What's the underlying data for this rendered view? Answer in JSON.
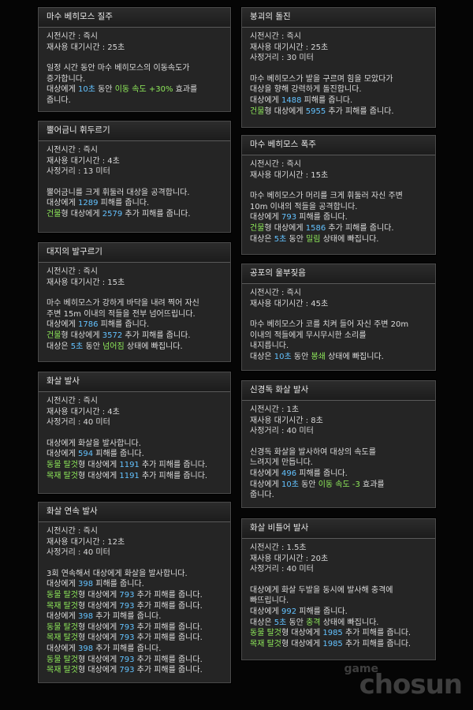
{
  "left": [
    {
      "title": "마수 베히모스 질주",
      "stats": [
        "시전시간 : 즉시",
        "재사용 대기시간 : 25초"
      ],
      "desc": [
        [
          {
            "t": "일정 시간 동안 마수 베히모스의 이동속도가",
            "c": "w"
          }
        ],
        [
          {
            "t": "증가합니다.",
            "c": "w"
          }
        ],
        [
          {
            "t": "대상에게 ",
            "c": "w"
          },
          {
            "t": "10초",
            "c": "b"
          },
          {
            "t": " 동안 ",
            "c": "w"
          },
          {
            "t": "이동 속도 +30%",
            "c": "g"
          },
          {
            "t": " 효과를",
            "c": "w"
          }
        ],
        [
          {
            "t": "줍니다.",
            "c": "w"
          }
        ]
      ]
    },
    {
      "title": "뿔어금니 휘두르기",
      "stats": [
        "시전시간 : 즉시",
        "재사용 대기시간 : 4초",
        "사정거리 : 13 미터"
      ],
      "desc": [
        [
          {
            "t": "뿔어금니를 크게 휘둘러 대상을 공격합니다.",
            "c": "w"
          }
        ],
        [
          {
            "t": "대상에게 ",
            "c": "w"
          },
          {
            "t": "1289",
            "c": "b"
          },
          {
            "t": " 피해를 줍니다.",
            "c": "w"
          }
        ],
        [
          {
            "t": "건물",
            "c": "g"
          },
          {
            "t": "형 대상에게 ",
            "c": "w"
          },
          {
            "t": "2579",
            "c": "b"
          },
          {
            "t": " 추가 피해를 줍니다.",
            "c": "w"
          }
        ]
      ]
    },
    {
      "title": "대지의 발구르기",
      "stats": [
        "시전시간 : 즉시",
        "재사용 대기시간 : 15초"
      ],
      "desc": [
        [
          {
            "t": "마수 베히모스가 강하게 바닥을 내려 찍어 자신",
            "c": "w"
          }
        ],
        [
          {
            "t": "주변 15m 이내의 적들을 전부 넘어뜨립니다.",
            "c": "w"
          }
        ],
        [
          {
            "t": "대상에게 ",
            "c": "w"
          },
          {
            "t": "1786",
            "c": "b"
          },
          {
            "t": " 피해를 줍니다.",
            "c": "w"
          }
        ],
        [
          {
            "t": "건물",
            "c": "g"
          },
          {
            "t": "형 대상에게 ",
            "c": "w"
          },
          {
            "t": "3572",
            "c": "b"
          },
          {
            "t": " 추가 피해를 줍니다.",
            "c": "w"
          }
        ],
        [
          {
            "t": "대상은 ",
            "c": "w"
          },
          {
            "t": "5초",
            "c": "b"
          },
          {
            "t": " 동안 ",
            "c": "w"
          },
          {
            "t": "넘어짐",
            "c": "g"
          },
          {
            "t": " 상태에 빠집니다.",
            "c": "w"
          }
        ]
      ]
    },
    {
      "title": "화살 발사",
      "stats": [
        "시전시간 : 즉시",
        "재사용 대기시간 : 4초",
        "사정거리 : 40 미터"
      ],
      "desc": [
        [
          {
            "t": "대상에게 화살을 발사합니다.",
            "c": "w"
          }
        ],
        [
          {
            "t": "대상에게 ",
            "c": "w"
          },
          {
            "t": "594",
            "c": "b"
          },
          {
            "t": " 피해를 줍니다.",
            "c": "w"
          }
        ],
        [
          {
            "t": "동물 탈것",
            "c": "g"
          },
          {
            "t": "형 대상에게 ",
            "c": "w"
          },
          {
            "t": "1191",
            "c": "b"
          },
          {
            "t": " 추가 피해를 줍니다.",
            "c": "w"
          }
        ],
        [
          {
            "t": "목재 탈것",
            "c": "g"
          },
          {
            "t": "형 대상에게 ",
            "c": "w"
          },
          {
            "t": "1191",
            "c": "b"
          },
          {
            "t": " 추가 피해를 줍니다.",
            "c": "w"
          }
        ]
      ]
    },
    {
      "title": "화살 연속 발사",
      "stats": [
        "시전시간 : 즉시",
        "재사용 대기시간 : 12초",
        "사정거리 : 40 미터"
      ],
      "desc": [
        [
          {
            "t": "3회 연속해서 대상에게 화살을 발사합니다.",
            "c": "w"
          }
        ],
        [
          {
            "t": "대상에게 ",
            "c": "w"
          },
          {
            "t": "398",
            "c": "b"
          },
          {
            "t": " 피해를 줍니다.",
            "c": "w"
          }
        ],
        [
          {
            "t": "동물 탈것",
            "c": "g"
          },
          {
            "t": "형 대상에게 ",
            "c": "w"
          },
          {
            "t": "793",
            "c": "b"
          },
          {
            "t": " 추가 피해를 줍니다.",
            "c": "w"
          }
        ],
        [
          {
            "t": "목재 탈것",
            "c": "g"
          },
          {
            "t": "형 대상에게 ",
            "c": "w"
          },
          {
            "t": "793",
            "c": "b"
          },
          {
            "t": " 추가 피해를 줍니다.",
            "c": "w"
          }
        ],
        [
          {
            "t": "대상에게 ",
            "c": "w"
          },
          {
            "t": "398",
            "c": "b"
          },
          {
            "t": " 추가 피해를 줍니다.",
            "c": "w"
          }
        ],
        [
          {
            "t": "동물 탈것",
            "c": "g"
          },
          {
            "t": "형 대상에게 ",
            "c": "w"
          },
          {
            "t": "793",
            "c": "b"
          },
          {
            "t": " 추가 피해를 줍니다.",
            "c": "w"
          }
        ],
        [
          {
            "t": "목재 탈것",
            "c": "g"
          },
          {
            "t": "형 대상에게 ",
            "c": "w"
          },
          {
            "t": "793",
            "c": "b"
          },
          {
            "t": " 추가 피해를 줍니다.",
            "c": "w"
          }
        ],
        [
          {
            "t": "대상에게 ",
            "c": "w"
          },
          {
            "t": "398",
            "c": "b"
          },
          {
            "t": " 추가 피해를 줍니다.",
            "c": "w"
          }
        ],
        [
          {
            "t": "동물 탈것",
            "c": "g"
          },
          {
            "t": "형 대상에게 ",
            "c": "w"
          },
          {
            "t": "793",
            "c": "b"
          },
          {
            "t": " 추가 피해를 줍니다.",
            "c": "w"
          }
        ],
        [
          {
            "t": "목재 탈것",
            "c": "g"
          },
          {
            "t": "형 대상에게 ",
            "c": "w"
          },
          {
            "t": "793",
            "c": "b"
          },
          {
            "t": " 추가 피해를 줍니다.",
            "c": "w"
          }
        ]
      ]
    }
  ],
  "right": [
    {
      "title": "붕괴의 돌진",
      "stats": [
        "시전시간 : 즉시",
        "재사용 대기시간 : 25초",
        "사정거리 : 30 미터"
      ],
      "desc": [
        [
          {
            "t": "마수 베히모스가 발을 구르며 힘을 모았다가",
            "c": "w"
          }
        ],
        [
          {
            "t": "대상을 향해 강력하게 돌진합니다.",
            "c": "w"
          }
        ],
        [
          {
            "t": "대상에게 ",
            "c": "w"
          },
          {
            "t": "1488",
            "c": "b"
          },
          {
            "t": " 피해를 줍니다.",
            "c": "w"
          }
        ],
        [
          {
            "t": "건물",
            "c": "g"
          },
          {
            "t": "형 대상에게 ",
            "c": "w"
          },
          {
            "t": "5955",
            "c": "b"
          },
          {
            "t": " 추가 피해를 줍니다.",
            "c": "w"
          }
        ]
      ]
    },
    {
      "title": "마수 베히모스 폭주",
      "stats": [
        "시전시간 : 즉시",
        "재사용 대기시간 : 15초"
      ],
      "desc": [
        [
          {
            "t": "마수 베히모스가 머리를 크게 휘둘러 자신 주변",
            "c": "w"
          }
        ],
        [
          {
            "t": "10m 이내의 적들을 공격합니다.",
            "c": "w"
          }
        ],
        [
          {
            "t": "대상에게 ",
            "c": "w"
          },
          {
            "t": "793",
            "c": "b"
          },
          {
            "t": " 피해를 줍니다.",
            "c": "w"
          }
        ],
        [
          {
            "t": "건물",
            "c": "g"
          },
          {
            "t": "형 대상에게 ",
            "c": "w"
          },
          {
            "t": "1586",
            "c": "b"
          },
          {
            "t": " 추가 피해를 줍니다.",
            "c": "w"
          }
        ],
        [
          {
            "t": "대상은 ",
            "c": "w"
          },
          {
            "t": "5초",
            "c": "b"
          },
          {
            "t": " 동안 ",
            "c": "w"
          },
          {
            "t": "밀림",
            "c": "g"
          },
          {
            "t": " 상태에 빠집니다.",
            "c": "w"
          }
        ]
      ]
    },
    {
      "title": "공포의 울부짖음",
      "stats": [
        "시전시간 : 즉시",
        "재사용 대기시간 : 45초"
      ],
      "desc": [
        [
          {
            "t": "마수 베히모스가 코를 치켜 들어 자신 주변 20m",
            "c": "w"
          }
        ],
        [
          {
            "t": "이내의 적들에게 무시무시한 소리를",
            "c": "w"
          }
        ],
        [
          {
            "t": "내지릅니다.",
            "c": "w"
          }
        ],
        [
          {
            "t": "대상은 ",
            "c": "w"
          },
          {
            "t": "10초",
            "c": "b"
          },
          {
            "t": " 동안 ",
            "c": "w"
          },
          {
            "t": "봉쇄",
            "c": "g"
          },
          {
            "t": " 상태에 빠집니다.",
            "c": "w"
          }
        ]
      ]
    },
    {
      "title": "신경독 화살 발사",
      "stats": [
        "시전시간 : 1초",
        "재사용 대기시간 : 8초",
        "사정거리 : 40 미터"
      ],
      "desc": [
        [
          {
            "t": "신경독 화살을 발사하여 대상의 속도를",
            "c": "w"
          }
        ],
        [
          {
            "t": "느려지게 만듭니다.",
            "c": "w"
          }
        ],
        [
          {
            "t": "대상에게 ",
            "c": "w"
          },
          {
            "t": "496",
            "c": "b"
          },
          {
            "t": " 피해를 줍니다.",
            "c": "w"
          }
        ],
        [
          {
            "t": "대상에게 ",
            "c": "w"
          },
          {
            "t": "10초",
            "c": "b"
          },
          {
            "t": " 동안 ",
            "c": "w"
          },
          {
            "t": "이동 속도 -3",
            "c": "g"
          },
          {
            "t": " 효과를",
            "c": "w"
          }
        ],
        [
          {
            "t": "줍니다.",
            "c": "w"
          }
        ]
      ]
    },
    {
      "title": "화살 비틀어 발사",
      "stats": [
        "시전시간 : 1.5초",
        "재사용 대기시간 : 20초",
        "사정거리 : 40 미터"
      ],
      "desc": [
        [
          {
            "t": "대상에게 화살 두발을 동시에 발사해 충격에",
            "c": "w"
          }
        ],
        [
          {
            "t": "빠뜨립니다.",
            "c": "w"
          }
        ],
        [
          {
            "t": "대상에게 ",
            "c": "w"
          },
          {
            "t": "992",
            "c": "b"
          },
          {
            "t": " 피해를 줍니다.",
            "c": "w"
          }
        ],
        [
          {
            "t": "대상은 ",
            "c": "w"
          },
          {
            "t": "5초",
            "c": "b"
          },
          {
            "t": " 동안 ",
            "c": "w"
          },
          {
            "t": "충격",
            "c": "g"
          },
          {
            "t": " 상태에 빠집니다.",
            "c": "w"
          }
        ],
        [
          {
            "t": "동물 탈것",
            "c": "g"
          },
          {
            "t": "형 대상에게 ",
            "c": "w"
          },
          {
            "t": "1985",
            "c": "b"
          },
          {
            "t": " 추가 피해를 줍니다.",
            "c": "w"
          }
        ],
        [
          {
            "t": "목재 탈것",
            "c": "g"
          },
          {
            "t": "형 대상에게 ",
            "c": "w"
          },
          {
            "t": "1985",
            "c": "b"
          },
          {
            "t": " 추가 피해를 줍니다.",
            "c": "w"
          }
        ]
      ]
    }
  ],
  "watermark": {
    "small": "game",
    "large": "chosun"
  }
}
